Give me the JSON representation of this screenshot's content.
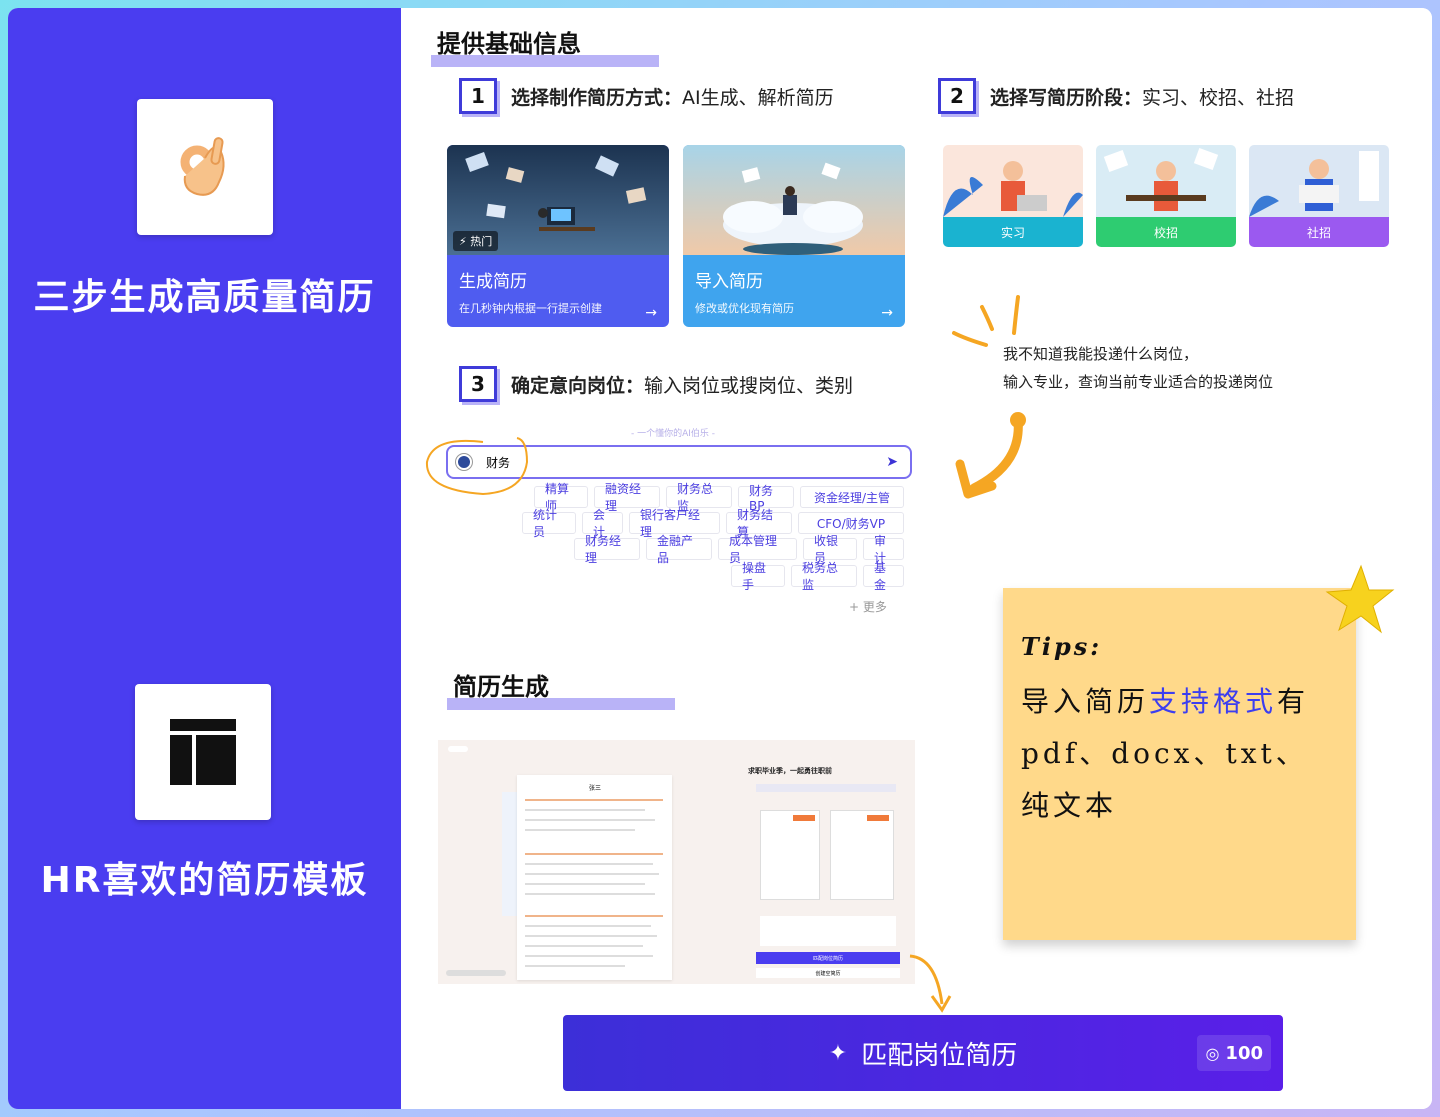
{
  "left": {
    "feature1": {
      "icon": "ok-hand-icon",
      "title": "三步生成高质量简历"
    },
    "feature2": {
      "icon": "layout-template-icon",
      "title": "HR喜欢的简历模板"
    }
  },
  "section1": {
    "title": "提供基础信息",
    "step1": {
      "num": "1",
      "bold": "选择制作简历方式：",
      "rest": "AI生成、解析简历"
    },
    "step2": {
      "num": "2",
      "bold": "选择写简历阶段：",
      "rest": "实习、校招、社招"
    },
    "step3": {
      "num": "3",
      "bold": "确定意向岗位：",
      "rest": "输入岗位或搜岗位、类别"
    },
    "cards": [
      {
        "tag": "热门",
        "title": "生成简历",
        "sub": "在几秒钟内根据一行提示创建",
        "arrow": "→"
      },
      {
        "title": "导入简历",
        "sub": "修改或优化现有简历",
        "arrow": "→"
      }
    ],
    "stages": [
      "实习",
      "校招",
      "社招"
    ],
    "note": [
      "我不知道我能投递什么岗位，",
      "输入专业，查询当前专业适合的投递岗位"
    ],
    "search": {
      "hint": "- 一个懂你的AI伯乐 -",
      "value": "财务"
    },
    "chips": [
      [
        "精算师",
        "融资经理",
        "财务总监",
        "财务BP",
        "资金经理/主管"
      ],
      [
        "统计员",
        "会计",
        "银行客户经理",
        "财务结算",
        "CFO/财务VP"
      ],
      [
        "财务经理",
        "金融产品",
        "成本管理员",
        "收银员",
        "审计"
      ],
      [
        "操盘手",
        "税务总监",
        "基金"
      ]
    ],
    "more": "+ 更多"
  },
  "section2": {
    "title": "简历生成",
    "preview": {
      "doc_name": "张三",
      "right_title": "求职毕业季，一起勇往职前",
      "match_btn": "匹配岗位简历",
      "new_btn": "创建空简历"
    }
  },
  "tips": {
    "label": "Tips:",
    "pre": "导入简历",
    "highlight": "支持格式",
    "post": "有",
    "line2": "pdf、docx、txt、",
    "line3": "纯文本"
  },
  "cta": {
    "label": "匹配岗位简历",
    "credits": "100"
  },
  "colors": {
    "brand": "#4a3df0",
    "green": "#2ecc71",
    "cyan": "#1ab3d0",
    "purple": "#9b59f0",
    "accent": "#f5a623"
  }
}
